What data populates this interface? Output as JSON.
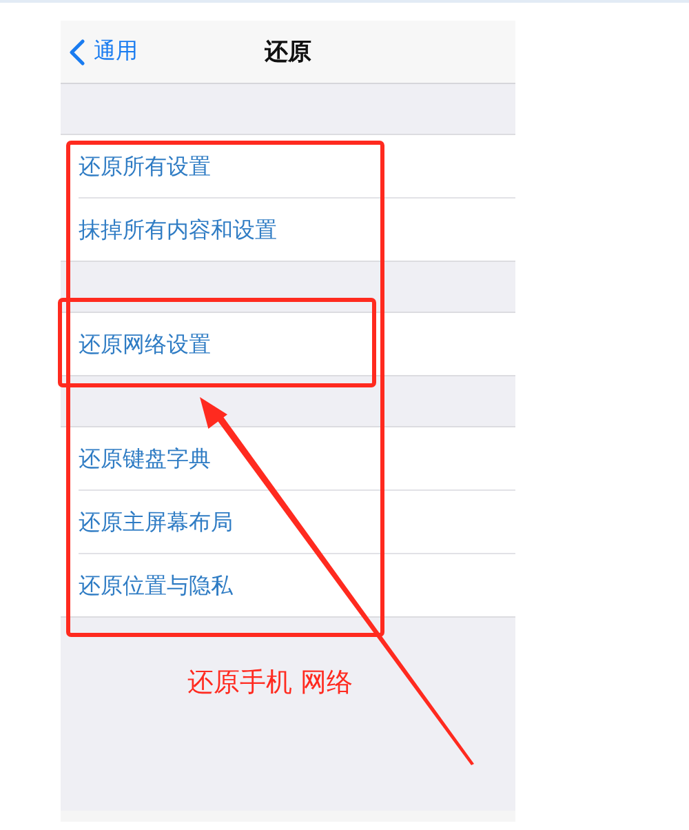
{
  "nav": {
    "back": "通用",
    "title": "还原"
  },
  "groups": [
    {
      "items": [
        {
          "label": "还原所有设置"
        },
        {
          "label": "抹掉所有内容和设置"
        }
      ]
    },
    {
      "items": [
        {
          "label": "还原网络设置"
        }
      ]
    },
    {
      "items": [
        {
          "label": "还原键盘字典"
        },
        {
          "label": "还原主屏幕布局"
        },
        {
          "label": "还原位置与隐私"
        }
      ]
    }
  ],
  "annotation": "还原手机 网络"
}
